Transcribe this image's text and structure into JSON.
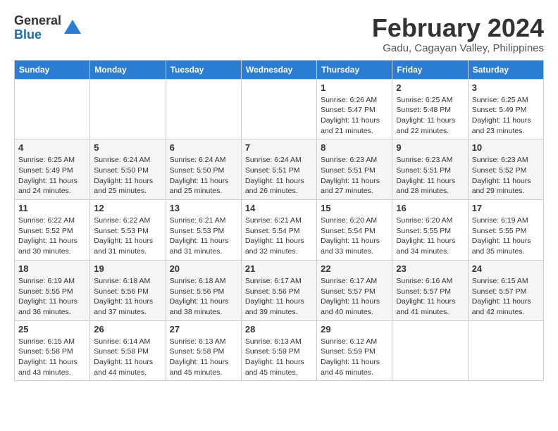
{
  "logo": {
    "general": "General",
    "blue": "Blue"
  },
  "title": {
    "month_year": "February 2024",
    "location": "Gadu, Cagayan Valley, Philippines"
  },
  "days_of_week": [
    "Sunday",
    "Monday",
    "Tuesday",
    "Wednesday",
    "Thursday",
    "Friday",
    "Saturday"
  ],
  "weeks": [
    [
      {
        "day": "",
        "info": ""
      },
      {
        "day": "",
        "info": ""
      },
      {
        "day": "",
        "info": ""
      },
      {
        "day": "",
        "info": ""
      },
      {
        "day": "1",
        "info": "Sunrise: 6:26 AM\nSunset: 5:47 PM\nDaylight: 11 hours and 21 minutes."
      },
      {
        "day": "2",
        "info": "Sunrise: 6:25 AM\nSunset: 5:48 PM\nDaylight: 11 hours and 22 minutes."
      },
      {
        "day": "3",
        "info": "Sunrise: 6:25 AM\nSunset: 5:49 PM\nDaylight: 11 hours and 23 minutes."
      }
    ],
    [
      {
        "day": "4",
        "info": "Sunrise: 6:25 AM\nSunset: 5:49 PM\nDaylight: 11 hours and 24 minutes."
      },
      {
        "day": "5",
        "info": "Sunrise: 6:24 AM\nSunset: 5:50 PM\nDaylight: 11 hours and 25 minutes."
      },
      {
        "day": "6",
        "info": "Sunrise: 6:24 AM\nSunset: 5:50 PM\nDaylight: 11 hours and 25 minutes."
      },
      {
        "day": "7",
        "info": "Sunrise: 6:24 AM\nSunset: 5:51 PM\nDaylight: 11 hours and 26 minutes."
      },
      {
        "day": "8",
        "info": "Sunrise: 6:23 AM\nSunset: 5:51 PM\nDaylight: 11 hours and 27 minutes."
      },
      {
        "day": "9",
        "info": "Sunrise: 6:23 AM\nSunset: 5:51 PM\nDaylight: 11 hours and 28 minutes."
      },
      {
        "day": "10",
        "info": "Sunrise: 6:23 AM\nSunset: 5:52 PM\nDaylight: 11 hours and 29 minutes."
      }
    ],
    [
      {
        "day": "11",
        "info": "Sunrise: 6:22 AM\nSunset: 5:52 PM\nDaylight: 11 hours and 30 minutes."
      },
      {
        "day": "12",
        "info": "Sunrise: 6:22 AM\nSunset: 5:53 PM\nDaylight: 11 hours and 31 minutes."
      },
      {
        "day": "13",
        "info": "Sunrise: 6:21 AM\nSunset: 5:53 PM\nDaylight: 11 hours and 31 minutes."
      },
      {
        "day": "14",
        "info": "Sunrise: 6:21 AM\nSunset: 5:54 PM\nDaylight: 11 hours and 32 minutes."
      },
      {
        "day": "15",
        "info": "Sunrise: 6:20 AM\nSunset: 5:54 PM\nDaylight: 11 hours and 33 minutes."
      },
      {
        "day": "16",
        "info": "Sunrise: 6:20 AM\nSunset: 5:55 PM\nDaylight: 11 hours and 34 minutes."
      },
      {
        "day": "17",
        "info": "Sunrise: 6:19 AM\nSunset: 5:55 PM\nDaylight: 11 hours and 35 minutes."
      }
    ],
    [
      {
        "day": "18",
        "info": "Sunrise: 6:19 AM\nSunset: 5:55 PM\nDaylight: 11 hours and 36 minutes."
      },
      {
        "day": "19",
        "info": "Sunrise: 6:18 AM\nSunset: 5:56 PM\nDaylight: 11 hours and 37 minutes."
      },
      {
        "day": "20",
        "info": "Sunrise: 6:18 AM\nSunset: 5:56 PM\nDaylight: 11 hours and 38 minutes."
      },
      {
        "day": "21",
        "info": "Sunrise: 6:17 AM\nSunset: 5:56 PM\nDaylight: 11 hours and 39 minutes."
      },
      {
        "day": "22",
        "info": "Sunrise: 6:17 AM\nSunset: 5:57 PM\nDaylight: 11 hours and 40 minutes."
      },
      {
        "day": "23",
        "info": "Sunrise: 6:16 AM\nSunset: 5:57 PM\nDaylight: 11 hours and 41 minutes."
      },
      {
        "day": "24",
        "info": "Sunrise: 6:15 AM\nSunset: 5:57 PM\nDaylight: 11 hours and 42 minutes."
      }
    ],
    [
      {
        "day": "25",
        "info": "Sunrise: 6:15 AM\nSunset: 5:58 PM\nDaylight: 11 hours and 43 minutes."
      },
      {
        "day": "26",
        "info": "Sunrise: 6:14 AM\nSunset: 5:58 PM\nDaylight: 11 hours and 44 minutes."
      },
      {
        "day": "27",
        "info": "Sunrise: 6:13 AM\nSunset: 5:58 PM\nDaylight: 11 hours and 45 minutes."
      },
      {
        "day": "28",
        "info": "Sunrise: 6:13 AM\nSunset: 5:59 PM\nDaylight: 11 hours and 45 minutes."
      },
      {
        "day": "29",
        "info": "Sunrise: 6:12 AM\nSunset: 5:59 PM\nDaylight: 11 hours and 46 minutes."
      },
      {
        "day": "",
        "info": ""
      },
      {
        "day": "",
        "info": ""
      }
    ]
  ]
}
